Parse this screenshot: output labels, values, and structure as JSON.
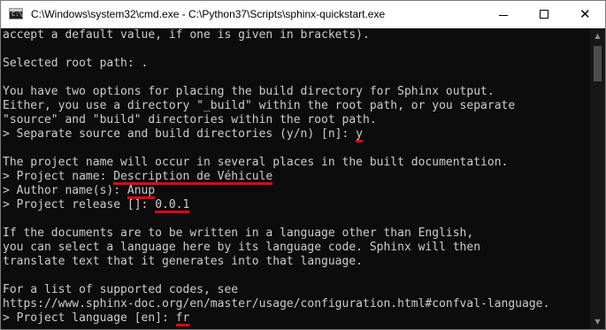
{
  "window": {
    "title": "C:\\Windows\\system32\\cmd.exe - C:\\Python37\\Scripts\\sphinx-quickstart.exe",
    "icon_text": "C:\\",
    "controls": {
      "minimize": "minimize-icon",
      "maximize": "maximize-icon",
      "close": "close-icon"
    }
  },
  "console": {
    "lines": [
      {
        "text": "accept a default value, if one is given in brackets)."
      },
      {
        "text": ""
      },
      {
        "text": "Selected root path: ."
      },
      {
        "text": ""
      },
      {
        "text": "You have two options for placing the build directory for Sphinx output."
      },
      {
        "text": "Either, you use a directory \"_build\" within the root path, or you separate"
      },
      {
        "text": "\"source\" and \"build\" directories within the root path."
      },
      {
        "prompt": "> Separate source and build directories (y/n) [n]: ",
        "input": "y"
      },
      {
        "text": ""
      },
      {
        "text": "The project name will occur in several places in the built documentation."
      },
      {
        "prompt": "> Project name: ",
        "input": "Description de Véhicule"
      },
      {
        "prompt": "> Author name(s): ",
        "input": "Anup"
      },
      {
        "prompt": "> Project release []: ",
        "input": "0.0.1"
      },
      {
        "text": ""
      },
      {
        "text": "If the documents are to be written in a language other than English,"
      },
      {
        "text": "you can select a language here by its language code. Sphinx will then"
      },
      {
        "text": "translate text that it generates into that language."
      },
      {
        "text": ""
      },
      {
        "text": "For a list of supported codes, see"
      },
      {
        "text": "https://www.sphinx-doc.org/en/master/usage/configuration.html#confval-language."
      },
      {
        "prompt": "> Project language [en]: ",
        "input": "fr"
      }
    ]
  },
  "colors": {
    "console_bg": "#0c0c0c",
    "console_text": "#cccccc",
    "underline": "#e3001b",
    "titlebar_bg": "#ffffff"
  }
}
